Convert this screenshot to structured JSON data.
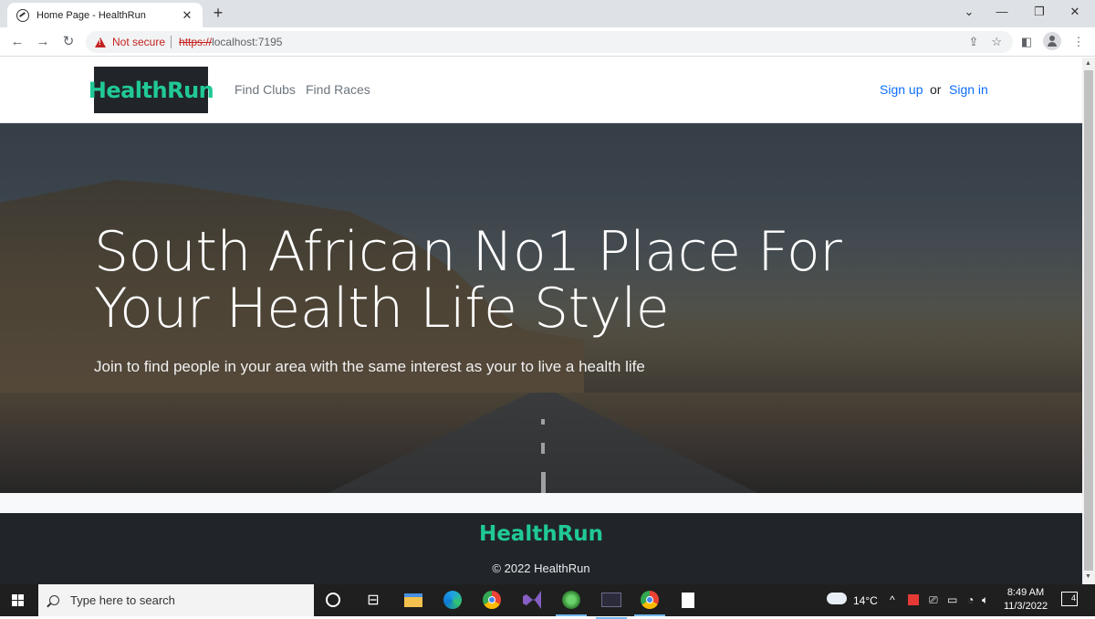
{
  "browser": {
    "tab_title": "Home Page - HealthRun",
    "tab_close": "✕",
    "new_tab": "+",
    "security_label": "Not secure",
    "url_scheme": "https://",
    "url_host": "localhost:7195"
  },
  "site": {
    "brand": "HealthRun",
    "nav": [
      "Find Clubs",
      "Find Races"
    ],
    "signup": "Sign up",
    "or": "or",
    "signin": "Sign in"
  },
  "hero": {
    "title": "South African No1 Place For Your Health Life Style",
    "subtitle": "Join to find people in your area with the same interest as your to live a health life"
  },
  "footer": {
    "brand": "HealthRun",
    "copyright": "© 2022 HealthRun"
  },
  "taskbar": {
    "search_placeholder": "Type here to search",
    "temperature": "14°C",
    "time": "8:49 AM",
    "date": "11/3/2022",
    "notification_count": "4"
  },
  "colors": {
    "brand_green": "#20c997",
    "link_blue": "#0d6efd",
    "warning_red": "#c5221f",
    "footer_dark": "#212529"
  }
}
